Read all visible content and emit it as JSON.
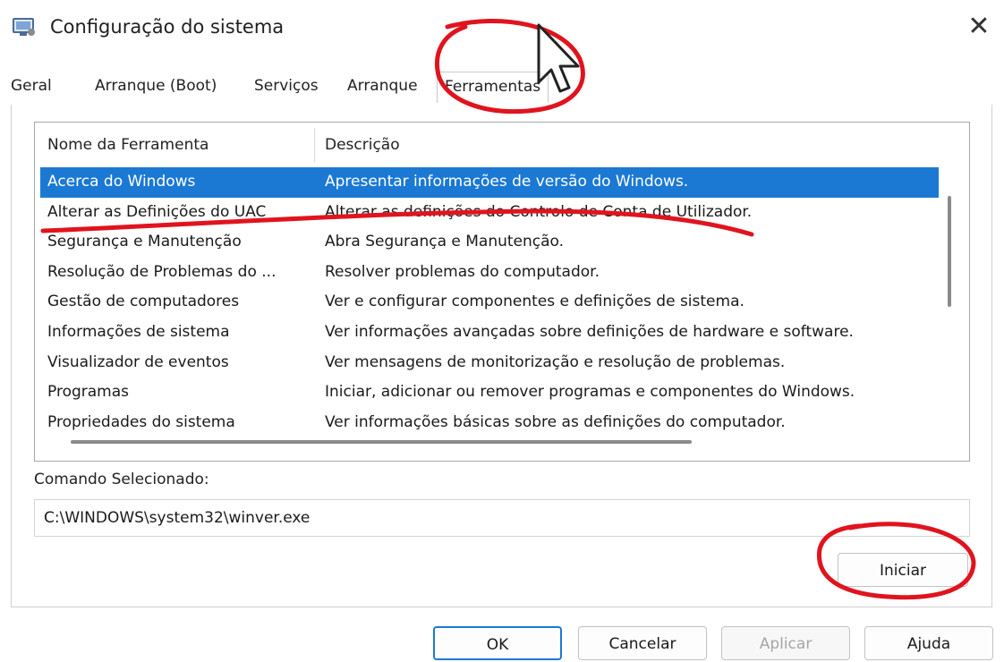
{
  "window": {
    "title": "Configuração do sistema",
    "close_glyph": "✕"
  },
  "tabs": [
    {
      "label": "Geral"
    },
    {
      "label": "Arranque (Boot)"
    },
    {
      "label": "Serviços"
    },
    {
      "label": "Arranque"
    },
    {
      "label": "Ferramentas",
      "active": true
    }
  ],
  "tools": {
    "columns": [
      "Nome da Ferramenta",
      "Descrição"
    ],
    "rows": [
      {
        "name": "Acerca do Windows",
        "desc": "Apresentar informações de versão do Windows.",
        "selected": true
      },
      {
        "name": "Alterar as Definições do UAC",
        "desc": "Alterar as definições do Controlo de Conta de Utilizador."
      },
      {
        "name": "Segurança e Manutenção",
        "desc": "Abra Segurança e Manutenção."
      },
      {
        "name": "Resolução de Problemas do ...",
        "desc": "Resolver problemas do computador."
      },
      {
        "name": "Gestão de computadores",
        "desc": "Ver e configurar componentes e definições de sistema."
      },
      {
        "name": "Informações de sistema",
        "desc": "Ver informações avançadas sobre definições de hardware e software."
      },
      {
        "name": "Visualizador de eventos",
        "desc": "Ver mensagens de monitorização e resolução de problemas."
      },
      {
        "name": "Programas",
        "desc": "Iniciar, adicionar ou remover programas e componentes do Windows."
      },
      {
        "name": "Propriedades do sistema",
        "desc": "Ver informações básicas sobre as definições do computador."
      }
    ]
  },
  "command": {
    "label": "Comando Selecionado:",
    "value": "C:\\WINDOWS\\system32\\winver.exe"
  },
  "buttons": {
    "launch": "Iniciar",
    "ok": "OK",
    "cancel": "Cancelar",
    "apply": "Aplicar",
    "help": "Ajuda"
  },
  "colors": {
    "selection": "#1b79d4",
    "annotation": "#e0141e"
  }
}
